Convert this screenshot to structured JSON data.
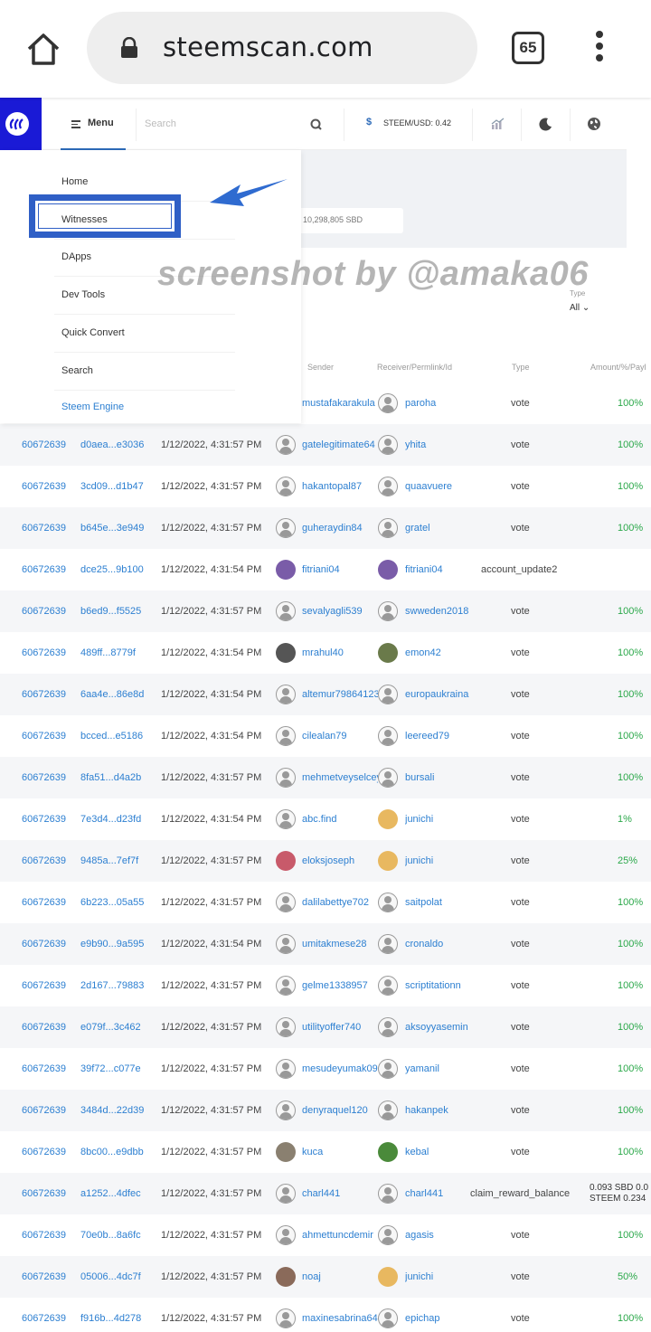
{
  "browser": {
    "url": "steemscan.com",
    "tab_count": "65"
  },
  "header": {
    "menu_label": "Menu",
    "search_placeholder": "Search",
    "price_symbol": "$",
    "price_label": "STEEM/USD: 0.42"
  },
  "stats": {
    "supply_text": "/ 10,298,805 SBD"
  },
  "filter": {
    "type_label": "Type",
    "type_value": "All ⌄"
  },
  "menu": {
    "items": [
      "Home",
      "Witnesses",
      "DApps",
      "Dev Tools",
      "Quick Convert",
      "Search",
      "Steem Engine"
    ]
  },
  "watermark": "screenshot by @amaka06",
  "table": {
    "columns": {
      "sender": "Sender",
      "receiver": "Receiver/Permlink/Id",
      "type": "Type",
      "amount": "Amount/%/Payl"
    },
    "first_row": {
      "sender": "mustafakarakula",
      "receiver": "paroha",
      "type": "vote",
      "amount": "100%"
    },
    "rows": [
      {
        "block": "60672639",
        "tx": "d0aea...e3036",
        "time": "1/12/2022, 4:31:57 PM",
        "sender": "gatelegitimate64",
        "receiver": "yhita",
        "type": "vote",
        "amount": "100%"
      },
      {
        "block": "60672639",
        "tx": "3cd09...d1b47",
        "time": "1/12/2022, 4:31:57 PM",
        "sender": "hakantopal87",
        "receiver": "quaavuere",
        "type": "vote",
        "amount": "100%"
      },
      {
        "block": "60672639",
        "tx": "b645e...3e949",
        "time": "1/12/2022, 4:31:57 PM",
        "sender": "guheraydin84",
        "receiver": "gratel",
        "type": "vote",
        "amount": "100%"
      },
      {
        "block": "60672639",
        "tx": "dce25...9b100",
        "time": "1/12/2022, 4:31:54 PM",
        "sender": "fitriani04",
        "receiver": "fitriani04",
        "type": "account_update2",
        "amount": ""
      },
      {
        "block": "60672639",
        "tx": "b6ed9...f5525",
        "time": "1/12/2022, 4:31:57 PM",
        "sender": "sevalyagli539",
        "receiver": "swweden2018",
        "type": "vote",
        "amount": "100%"
      },
      {
        "block": "60672639",
        "tx": "489ff...8779f",
        "time": "1/12/2022, 4:31:54 PM",
        "sender": "mrahul40",
        "receiver": "emon42",
        "type": "vote",
        "amount": "100%"
      },
      {
        "block": "60672639",
        "tx": "6aa4e...86e8d",
        "time": "1/12/2022, 4:31:54 PM",
        "sender": "altemur79864123",
        "receiver": "europaukraina",
        "type": "vote",
        "amount": "100%"
      },
      {
        "block": "60672639",
        "tx": "bcced...e5186",
        "time": "1/12/2022, 4:31:54 PM",
        "sender": "cilealan79",
        "receiver": "leereed79",
        "type": "vote",
        "amount": "100%"
      },
      {
        "block": "60672639",
        "tx": "8fa51...d4a2b",
        "time": "1/12/2022, 4:31:57 PM",
        "sender": "mehmetveyselcey",
        "receiver": "bursali",
        "type": "vote",
        "amount": "100%"
      },
      {
        "block": "60672639",
        "tx": "7e3d4...d23fd",
        "time": "1/12/2022, 4:31:54 PM",
        "sender": "abc.find",
        "receiver": "junichi",
        "type": "vote",
        "amount": "1%"
      },
      {
        "block": "60672639",
        "tx": "9485a...7ef7f",
        "time": "1/12/2022, 4:31:57 PM",
        "sender": "eloksjoseph",
        "receiver": "junichi",
        "type": "vote",
        "amount": "25%"
      },
      {
        "block": "60672639",
        "tx": "6b223...05a55",
        "time": "1/12/2022, 4:31:57 PM",
        "sender": "dalilabettye702",
        "receiver": "saitpolat",
        "type": "vote",
        "amount": "100%"
      },
      {
        "block": "60672639",
        "tx": "e9b90...9a595",
        "time": "1/12/2022, 4:31:54 PM",
        "sender": "umitakmese28",
        "receiver": "cronaldo",
        "type": "vote",
        "amount": "100%"
      },
      {
        "block": "60672639",
        "tx": "2d167...79883",
        "time": "1/12/2022, 4:31:57 PM",
        "sender": "gelme1338957",
        "receiver": "scriptitationn",
        "type": "vote",
        "amount": "100%"
      },
      {
        "block": "60672639",
        "tx": "e079f...3c462",
        "time": "1/12/2022, 4:31:57 PM",
        "sender": "utilityoffer740",
        "receiver": "aksoyyasemin",
        "type": "vote",
        "amount": "100%"
      },
      {
        "block": "60672639",
        "tx": "39f72...c077e",
        "time": "1/12/2022, 4:31:57 PM",
        "sender": "mesudeyumak09",
        "receiver": "yamanil",
        "type": "vote",
        "amount": "100%"
      },
      {
        "block": "60672639",
        "tx": "3484d...22d39",
        "time": "1/12/2022, 4:31:57 PM",
        "sender": "denyraquel120",
        "receiver": "hakanpek",
        "type": "vote",
        "amount": "100%"
      },
      {
        "block": "60672639",
        "tx": "8bc00...e9dbb",
        "time": "1/12/2022, 4:31:57 PM",
        "sender": "kuca",
        "receiver": "kebal",
        "type": "vote",
        "amount": "100%"
      },
      {
        "block": "60672639",
        "tx": "a1252...4dfec",
        "time": "1/12/2022, 4:31:57 PM",
        "sender": "charl441",
        "receiver": "charl441",
        "type": "claim_reward_balance",
        "amount": "0.093 SBD 0.0",
        "amount2": "STEEM 0.234"
      },
      {
        "block": "60672639",
        "tx": "70e0b...8a6fc",
        "time": "1/12/2022, 4:31:57 PM",
        "sender": "ahmettuncdemir",
        "receiver": "agasis",
        "type": "vote",
        "amount": "100%"
      },
      {
        "block": "60672639",
        "tx": "05006...4dc7f",
        "time": "1/12/2022, 4:31:57 PM",
        "sender": "noaj",
        "receiver": "junichi",
        "type": "vote",
        "amount": "50%"
      },
      {
        "block": "60672639",
        "tx": "f916b...4d278",
        "time": "1/12/2022, 4:31:57 PM",
        "sender": "maxinesabrina64",
        "receiver": "epichap",
        "type": "vote",
        "amount": "100%"
      }
    ]
  },
  "colors": {
    "link": "#2c7fd1",
    "positive": "#2ba84a",
    "brand": "#1a1ad6",
    "annotation": "#2f5fc6"
  }
}
